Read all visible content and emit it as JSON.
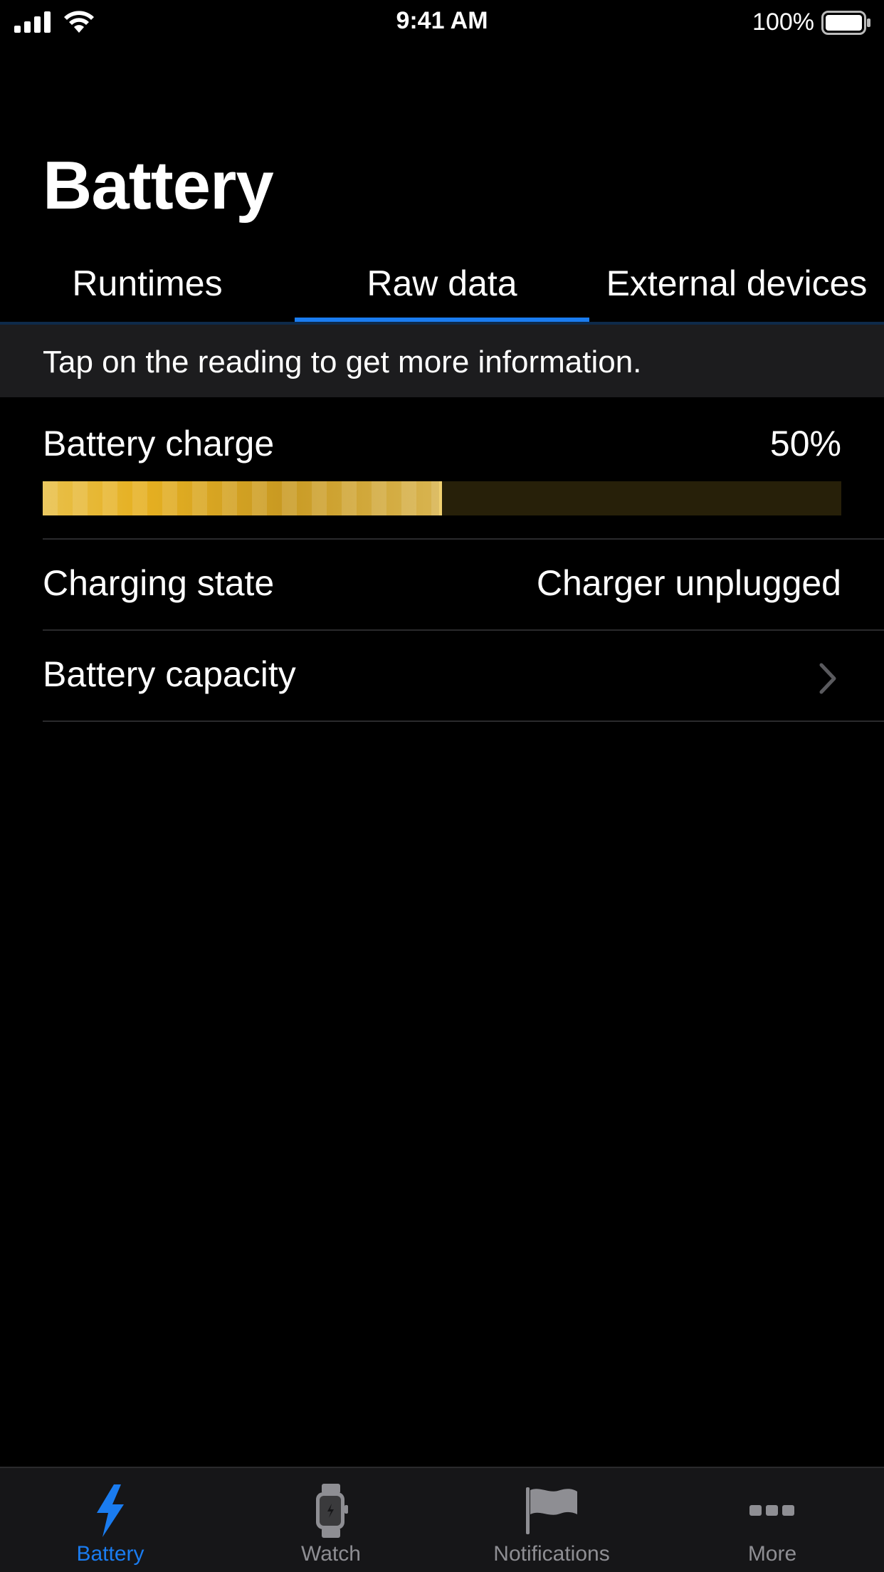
{
  "status_bar": {
    "time": "9:41 AM",
    "battery_percent": "100%",
    "icons": [
      "signal-icon",
      "wifi-icon",
      "battery-icon"
    ]
  },
  "page": {
    "title": "Battery"
  },
  "tabs": [
    {
      "label": "Runtimes",
      "selected": false
    },
    {
      "label": "Raw data",
      "selected": true
    },
    {
      "label": "External devices",
      "selected": false
    }
  ],
  "hint": {
    "text": "Tap on the reading to get more information."
  },
  "readings": {
    "battery_charge": {
      "label": "Battery charge",
      "value": "50%",
      "level": 0.5
    },
    "charging_state": {
      "label": "Charging state",
      "value": "Charger unplugged"
    },
    "battery_capacity": {
      "label": "Battery capacity",
      "icon": "chevron-right-icon"
    }
  },
  "tab_bar": {
    "items": [
      {
        "label": "Battery",
        "icon": "lightning-bolt-icon",
        "active": true
      },
      {
        "label": "Watch",
        "icon": "watch-icon",
        "active": false
      },
      {
        "label": "Notifications",
        "icon": "flag-icon",
        "active": false
      },
      {
        "label": "More",
        "icon": "more-dots-icon",
        "active": false
      }
    ]
  },
  "colors": {
    "accent": "#1a7cf0",
    "background": "#000000",
    "banner": "#1c1c1e",
    "bar_fill": "#e6b021",
    "bar_track": "#272009",
    "inactive": "#8e8e93"
  }
}
